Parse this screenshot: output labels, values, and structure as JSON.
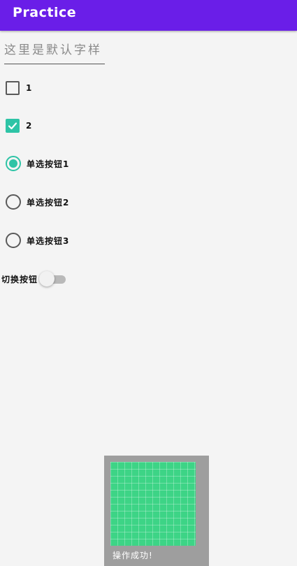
{
  "app_bar": {
    "title": "Practice",
    "color": "#6a1ee8"
  },
  "edit_text": {
    "placeholder": "这里是默认字样",
    "value": ""
  },
  "checkboxes": [
    {
      "label": "1",
      "checked": false
    },
    {
      "label": "2",
      "checked": true
    }
  ],
  "radios": [
    {
      "label": "单选按钮1",
      "checked": true
    },
    {
      "label": "单选按钮2",
      "checked": false
    },
    {
      "label": "单选按钮3",
      "checked": false
    }
  ],
  "switch": {
    "label": "切换按钮",
    "on": false
  },
  "toast": {
    "text": "操作成功!"
  },
  "colors": {
    "accent": "#2ec4a6",
    "toast_bg": "#9e9e9e",
    "image_green": "#3dd486"
  }
}
